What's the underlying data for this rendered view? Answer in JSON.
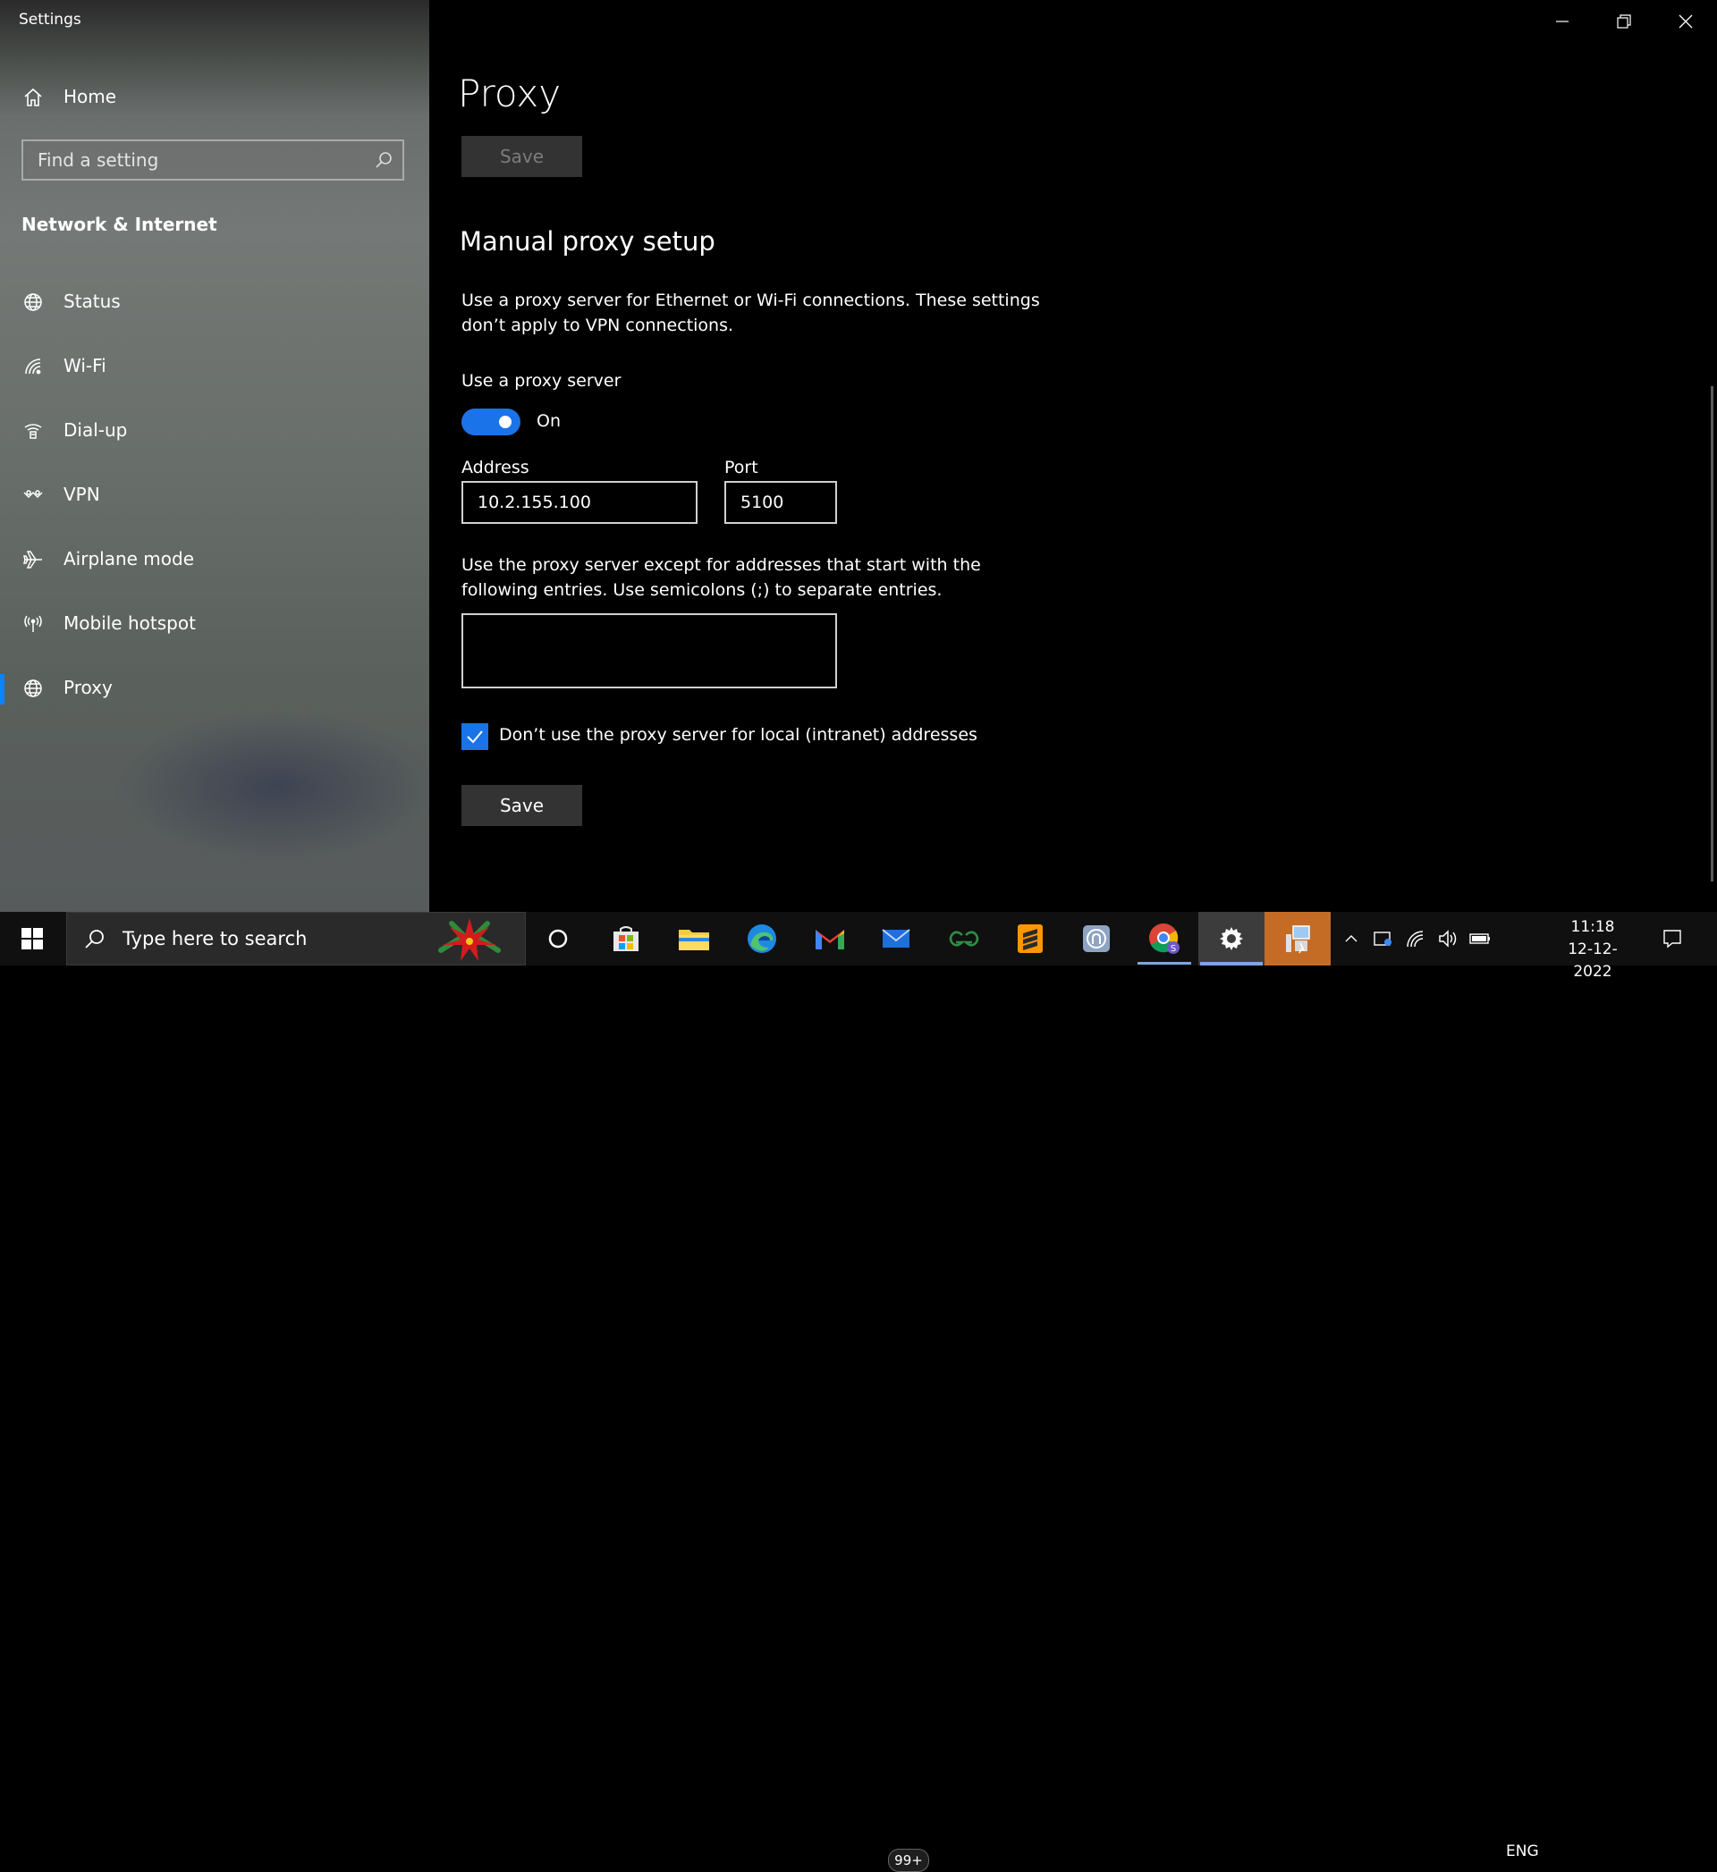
{
  "window": {
    "title": "Settings"
  },
  "sidebar": {
    "home_label": "Home",
    "search_placeholder": "Find a setting",
    "section": "Network & Internet",
    "items": [
      {
        "label": "Status",
        "icon": "globe-status-icon"
      },
      {
        "label": "Wi-Fi",
        "icon": "wifi-icon"
      },
      {
        "label": "Dial-up",
        "icon": "dialup-icon"
      },
      {
        "label": "VPN",
        "icon": "vpn-icon"
      },
      {
        "label": "Airplane mode",
        "icon": "airplane-icon"
      },
      {
        "label": "Mobile hotspot",
        "icon": "hotspot-icon"
      },
      {
        "label": "Proxy",
        "icon": "globe-icon",
        "selected": true
      }
    ]
  },
  "main": {
    "title": "Proxy",
    "save_top_label": "Save",
    "manual_heading": "Manual proxy setup",
    "manual_description": "Use a proxy server for Ethernet or Wi-Fi connections. These settings don’t apply to VPN connections.",
    "use_proxy_label": "Use a proxy server",
    "toggle_state": "On",
    "address_label": "Address",
    "address_value": "10.2.155.100",
    "port_label": "Port",
    "port_value": "5100",
    "exceptions_description": "Use the proxy server except for addresses that start with the following entries. Use semicolons (;) to separate entries.",
    "exceptions_value": "",
    "local_checkbox_label": "Don’t use the proxy server for local (intranet) addresses",
    "local_checkbox_checked": true,
    "save_bottom_label": "Save"
  },
  "taskbar": {
    "search_placeholder": "Type here to search",
    "mail_badge": "99+",
    "language": "ENG",
    "time": "11:18",
    "date": "12-12-2022"
  },
  "colors": {
    "accent": "#1a73e8",
    "selection_bar": "#0a84ff"
  }
}
